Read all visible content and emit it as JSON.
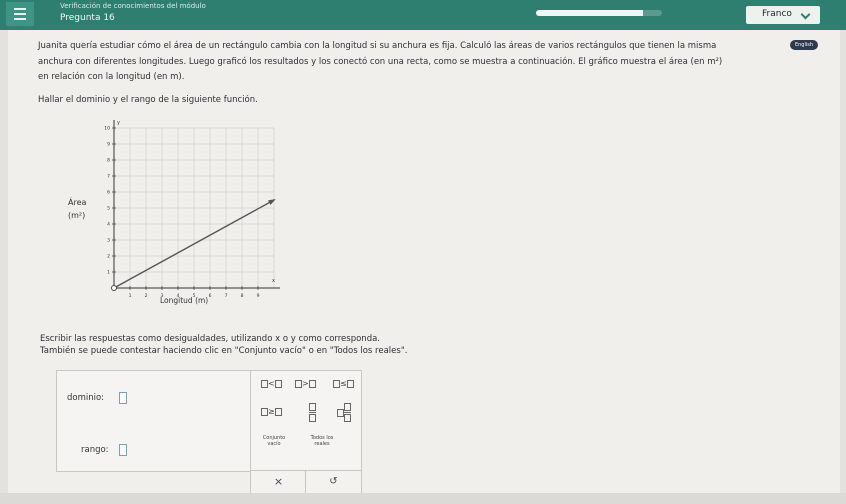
{
  "header": {
    "module_title": "Verificación de conocimientos del módulo",
    "question_label": "Pregunta 16",
    "progress_fraction": 0.85,
    "user_name": "Franco",
    "menu_icon": "hamburger-icon",
    "user_chevron_icon": "chevron-down-icon"
  },
  "english_label": "English",
  "problem": {
    "line1": "Juanita quería estudiar cómo el área de un rectángulo cambia con la longitud si su anchura es fija. Calculó las áreas de varios rectángulos que tienen la misma",
    "line2": "anchura con diferentes longitudes. Luego graficó los resultados y los conectó con una recta, como se muestra a continuación. El gráfico muestra el área (en",
    "line2_unit": "m²)",
    "line3": "en relación con la longitud (en m).",
    "instruction": "Hallar el dominio y el rango de la siguiente función.",
    "note1": "Escribir las respuestas como desigualdades, utilizando x o y como corresponda.",
    "note2": "También se puede contestar haciendo clic en \"Conjunto vacío\" o en \"Todos los reales\"."
  },
  "chart_data": {
    "type": "line",
    "ylabel": "Área (m²)",
    "xlabel": "Longitud (m)",
    "x_axis_symbol": "x",
    "y_axis_symbol": "y",
    "xlim": [
      0,
      10
    ],
    "ylim": [
      0,
      10
    ],
    "x_ticks": [
      1,
      2,
      3,
      4,
      5,
      6,
      7,
      8,
      9
    ],
    "y_ticks": [
      1,
      2,
      3,
      4,
      5,
      6,
      7,
      8,
      9,
      10
    ],
    "x_tick_labels": [
      "1",
      "2",
      "3",
      "4",
      "5",
      "6",
      "7",
      "8",
      "9"
    ],
    "y_tick_labels": [
      "1",
      "2",
      "3",
      "4",
      "5",
      "6",
      "7",
      "8",
      "9",
      "10"
    ],
    "grid": true,
    "series": [
      {
        "points": [
          [
            0,
            0
          ],
          [
            10,
            5.5
          ]
        ],
        "start_marker": "open",
        "end_marker": "arrow"
      }
    ]
  },
  "answers": {
    "domain_label": "dominio:",
    "range_label": "rango:"
  },
  "keypad": {
    "lt": "<",
    "gt": ">",
    "le": "≤",
    "ge": "≥",
    "empty_set_label": "Conjunto vacío",
    "all_reals_label": "Todos los reales"
  },
  "actions": {
    "clear_label": "×",
    "undo_label": "↺"
  }
}
